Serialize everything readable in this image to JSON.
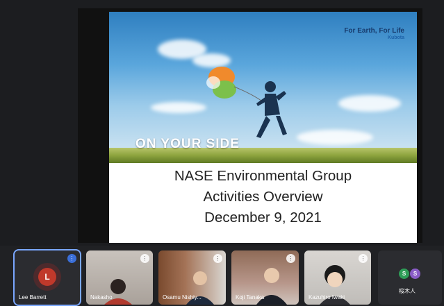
{
  "slide": {
    "brand_tagline": "For Earth, For Life",
    "brand_name": "Kubota",
    "photo_tagline": "ON YOUR SIDE",
    "title_line1": "NASE Environmental Group",
    "title_line2": "Activities Overview",
    "title_line3": "December 9, 2021"
  },
  "participants": [
    {
      "name": "Lee Barrett",
      "avatar_letter": "L",
      "avatar_color": "#c0392b"
    },
    {
      "name": "Nakasho"
    },
    {
      "name": "Osamu Nishiy..."
    },
    {
      "name": "Koji Tanaka"
    },
    {
      "name": "Kazuhiro Iwaki"
    },
    {
      "name": "桜木人",
      "avatar_letters": [
        "S",
        "S"
      ]
    }
  ],
  "icons": {
    "more_options": "more-options-icon",
    "audio": "audio-indicator-icon"
  }
}
